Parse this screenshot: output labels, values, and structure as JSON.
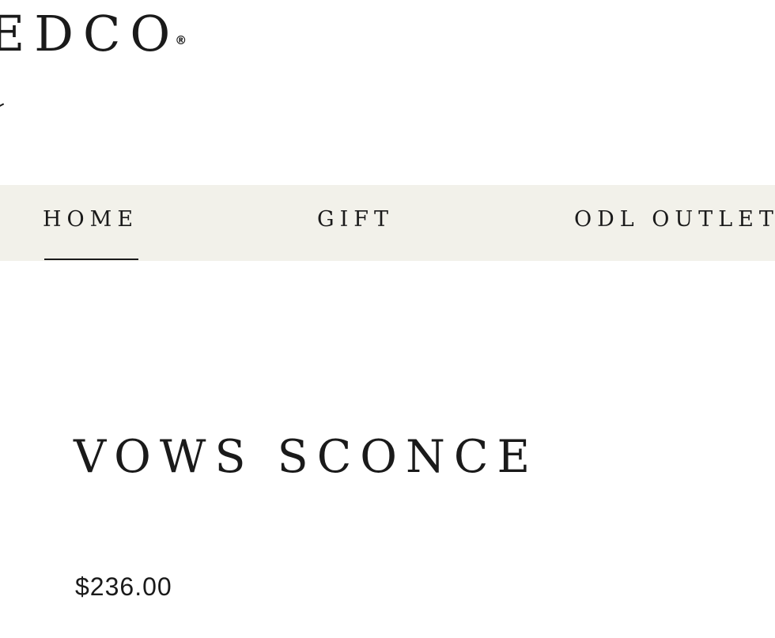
{
  "header": {
    "logo_text": "EDCO",
    "logo_mark": "®"
  },
  "nav": {
    "items": [
      {
        "label": "HOME",
        "active": true
      },
      {
        "label": "GIFT",
        "active": false
      },
      {
        "label": "ODL OUTLET",
        "active": false
      }
    ],
    "background": "#f2f1ea"
  },
  "product": {
    "title": "VOWS SCONCE",
    "price": "$236.00"
  }
}
